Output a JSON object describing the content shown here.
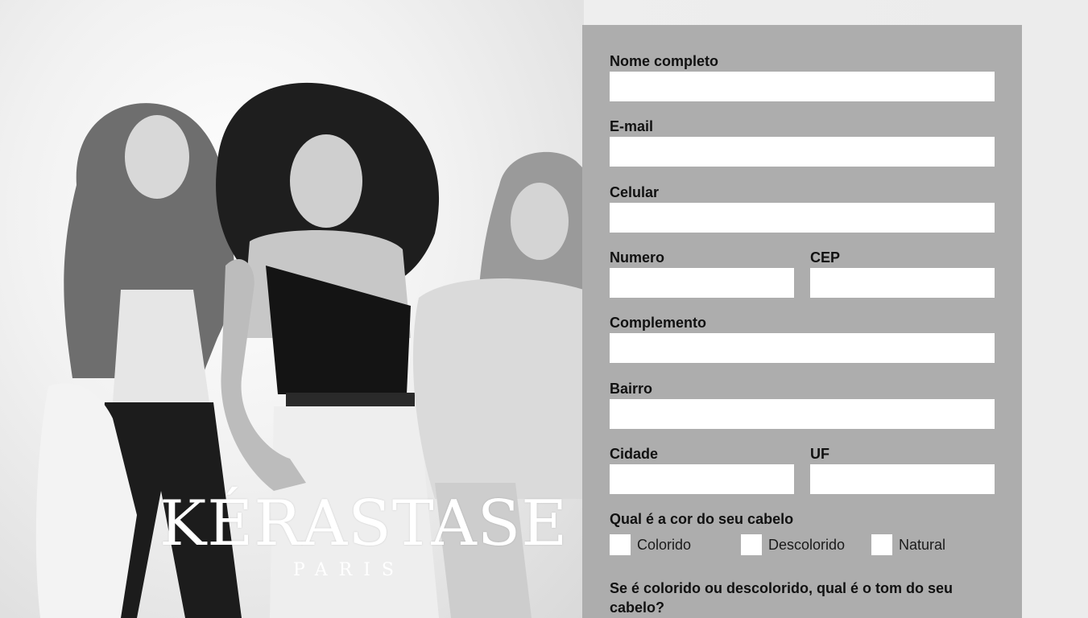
{
  "brand": {
    "name": "KÉRASTASE",
    "subtitle": "PARIS"
  },
  "form": {
    "fields": {
      "nome": {
        "label": "Nome completo",
        "value": ""
      },
      "email": {
        "label": "E-mail",
        "value": ""
      },
      "celular": {
        "label": "Celular",
        "value": ""
      },
      "numero": {
        "label": "Numero",
        "value": ""
      },
      "cep": {
        "label": "CEP",
        "value": ""
      },
      "complemento": {
        "label": "Complemento",
        "value": ""
      },
      "bairro": {
        "label": "Bairro",
        "value": ""
      },
      "cidade": {
        "label": "Cidade",
        "value": ""
      },
      "uf": {
        "label": "UF",
        "value": ""
      }
    },
    "hair_color": {
      "question": "Qual é a cor do seu cabelo",
      "options": [
        "Colorido",
        "Descolorido",
        "Natural"
      ]
    },
    "tone_question": "Se é colorido ou descolorido, qual é o tom do seu cabelo?"
  },
  "colors": {
    "panel_bg": "#adadad",
    "input_bg": "#ffffff",
    "label_text": "#111111"
  }
}
